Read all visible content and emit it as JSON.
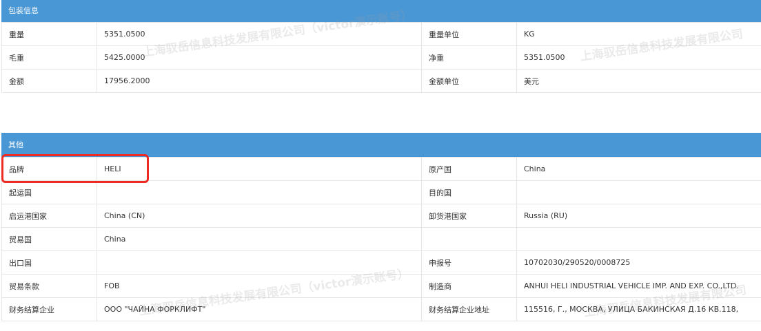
{
  "packaging": {
    "title": "包装信息",
    "rows": [
      [
        "重量",
        "5351.0500",
        "重量单位",
        "KG"
      ],
      [
        "毛重",
        "5425.0000",
        "净重",
        "5351.0500"
      ],
      [
        "金额",
        "17956.2000",
        "金额单位",
        "美元"
      ]
    ]
  },
  "other": {
    "title": "其他",
    "rows": [
      [
        "品牌",
        "HELI",
        "原产国",
        "China"
      ],
      [
        "起运国",
        "",
        "目的国",
        ""
      ],
      [
        "启运港国家",
        "China (CN)",
        "卸货港国家",
        "Russia (RU)"
      ],
      [
        "贸易国",
        "China",
        "",
        ""
      ],
      [
        "出口国",
        "",
        "申报号",
        "10702030/290520/0008725"
      ],
      [
        "贸易条款",
        "FOB",
        "制造商",
        "ANHUI HELI INDUSTRIAL VEHICLE IMP. AND EXP. CO.,LTD."
      ],
      [
        "财务结算企业",
        "ООО \"ЧАЙНА ФОРКЛИФТ\"",
        "财务结算企业地址",
        "115516, Г., МОСКВА, УЛИЦА БАКИНСКАЯ Д.16 КВ.118,"
      ]
    ]
  },
  "watermarks": [
    "上海驭岳信息科技发展有限公司（victor演示账号）",
    "上海驭岳信息科技发展有限公司",
    "上海驭岳信息科技发展有限公司（victor演示账号）",
    "上海驭岳信息科技发展有限公司"
  ]
}
